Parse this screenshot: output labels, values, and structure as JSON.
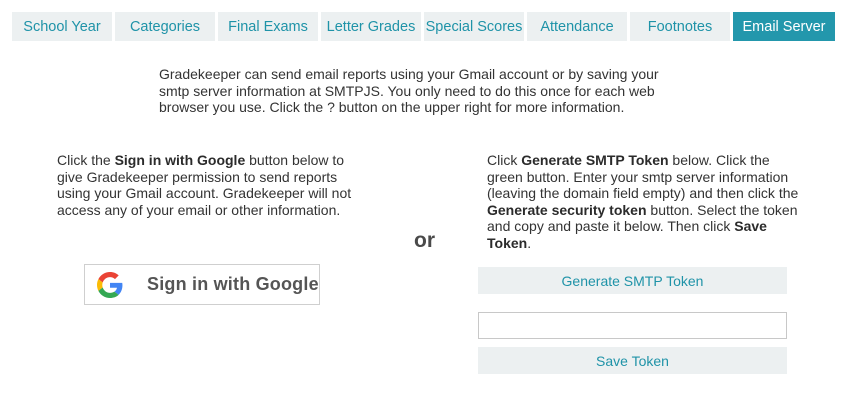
{
  "tabs": [
    {
      "label": "School Year"
    },
    {
      "label": "Categories"
    },
    {
      "label": "Final Exams"
    },
    {
      "label": "Letter Grades"
    },
    {
      "label": "Special Scores"
    },
    {
      "label": "Attendance"
    },
    {
      "label": "Footnotes"
    },
    {
      "label": "Email Server",
      "active": true
    }
  ],
  "intro": "Gradekeeper can send email reports using your Gmail account or by saving your smtp server information at SMTPJS. You only need to do this once for each web browser you use. Click the ? button on the upper right for more information.",
  "left": {
    "t1": "Click the ",
    "b1": "Sign in with Google",
    "t2": " button below to give Gradekeeper permission to send reports using your Gmail account. Gradekeeper will not access any of your email or other information."
  },
  "or_label": "or",
  "right": {
    "t1": "Click ",
    "b1": "Generate SMTP Token",
    "t2": " below. Click the green button. Enter your smtp server information (leaving the domain field empty) and then click the ",
    "b2": "Generate security token",
    "t3": " button. Select the token and copy and paste it below. Then click ",
    "b3": "Save Token",
    "t4": "."
  },
  "google_button": {
    "label": "Sign in with Google",
    "icon": "google-g-icon"
  },
  "generate_button": {
    "label": "Generate SMTP Token"
  },
  "token_input": {
    "value": "",
    "placeholder": ""
  },
  "save_button": {
    "label": "Save Token"
  },
  "colors": {
    "accent": "#2397ac",
    "tab_bg": "#ecf0f1",
    "tab_text": "#1f93a8"
  }
}
